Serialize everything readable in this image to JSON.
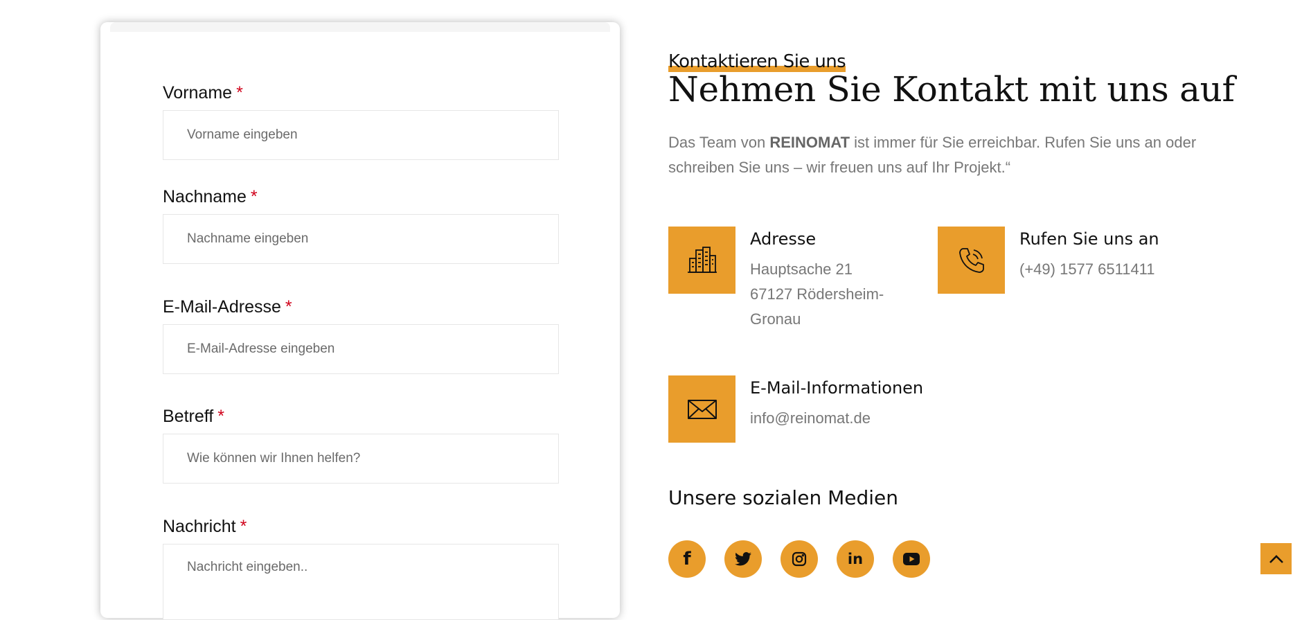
{
  "form": {
    "fields": [
      {
        "label": "Vorname",
        "required": "*",
        "placeholder": "Vorname eingeben"
      },
      {
        "label": "Nachname",
        "required": "*",
        "placeholder": "Nachname eingeben"
      },
      {
        "label": "E-Mail-Adresse",
        "required": "*",
        "placeholder": "E-Mail-Adresse eingeben"
      },
      {
        "label": "Betreff",
        "required": "*",
        "placeholder": "Wie können wir Ihnen helfen?"
      },
      {
        "label": "Nachricht",
        "required": "*",
        "placeholder": "Nachricht eingeben.."
      }
    ]
  },
  "contact": {
    "eyebrow": "Kontaktieren Sie uns",
    "headline": "Nehmen Sie Kontakt mit uns auf",
    "intro_before": "Das Team von ",
    "intro_brand": "REINOMAT",
    "intro_after": " ist immer für Sie erreichbar. Rufen Sie uns an oder schreiben Sie uns – wir freuen uns auf Ihr Projekt.“",
    "address": {
      "title": "Adresse",
      "line1": "Hauptsache 21",
      "line2": "67127 Rödersheim-Gronau",
      "icon": "building-icon"
    },
    "phone": {
      "title": "Rufen Sie uns an",
      "line1": "(+49) 1577 6511411",
      "icon": "phone-icon"
    },
    "email": {
      "title": "E-Mail-Informationen",
      "line1": "info@reinomat.de",
      "icon": "envelope-icon"
    }
  },
  "social": {
    "title": "Unsere sozialen Medien",
    "items": [
      {
        "name": "facebook",
        "glyph": "f"
      },
      {
        "name": "twitter",
        "glyph": ""
      },
      {
        "name": "instagram",
        "glyph": ""
      },
      {
        "name": "linkedin",
        "glyph": "in"
      },
      {
        "name": "youtube",
        "glyph": ""
      }
    ]
  },
  "colors": {
    "accent": "#e99d2c",
    "required": "#d0021b",
    "text": "#111111",
    "muted": "#777777"
  }
}
